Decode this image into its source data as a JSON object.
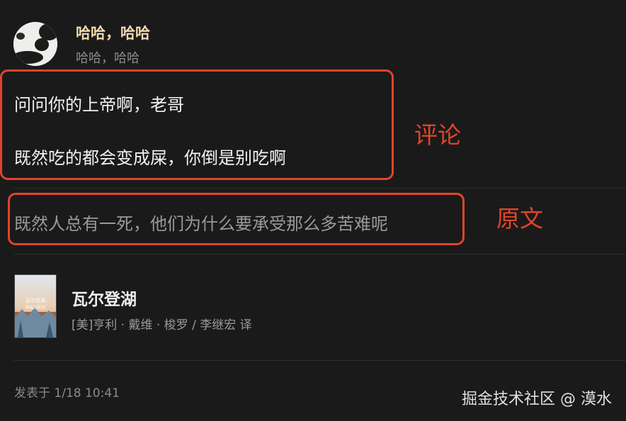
{
  "user": {
    "name": "哈哈，哈哈",
    "subtitle": "哈哈，哈哈",
    "avatar_icon": "panda-avatar-icon"
  },
  "comment": {
    "lines": [
      "问问你的上帝啊，老哥",
      "既然吃的都会变成屎，你倒是别吃啊"
    ]
  },
  "original": {
    "text": "既然人总有一死，他们为什么要承受那么多苦难呢"
  },
  "annotations": {
    "comment_label": "评论",
    "original_label": "原文",
    "color": "#e0442b"
  },
  "book": {
    "title": "瓦尔登湖",
    "author": "[美]亨利 · 戴维 · 梭罗 / 李继宏 译",
    "cover_icon": "book-cover-image",
    "cover_text": {
      "title": "瓦尔登湖",
      "latin": "WALDEN"
    }
  },
  "footer": {
    "posted": "发表于 1/18 10:41"
  },
  "watermark": {
    "text": "掘金技术社区 @ 漠水"
  },
  "colors": {
    "background": "#1a1a1a",
    "username": "#f3d9b1",
    "annotation": "#e0442b"
  }
}
